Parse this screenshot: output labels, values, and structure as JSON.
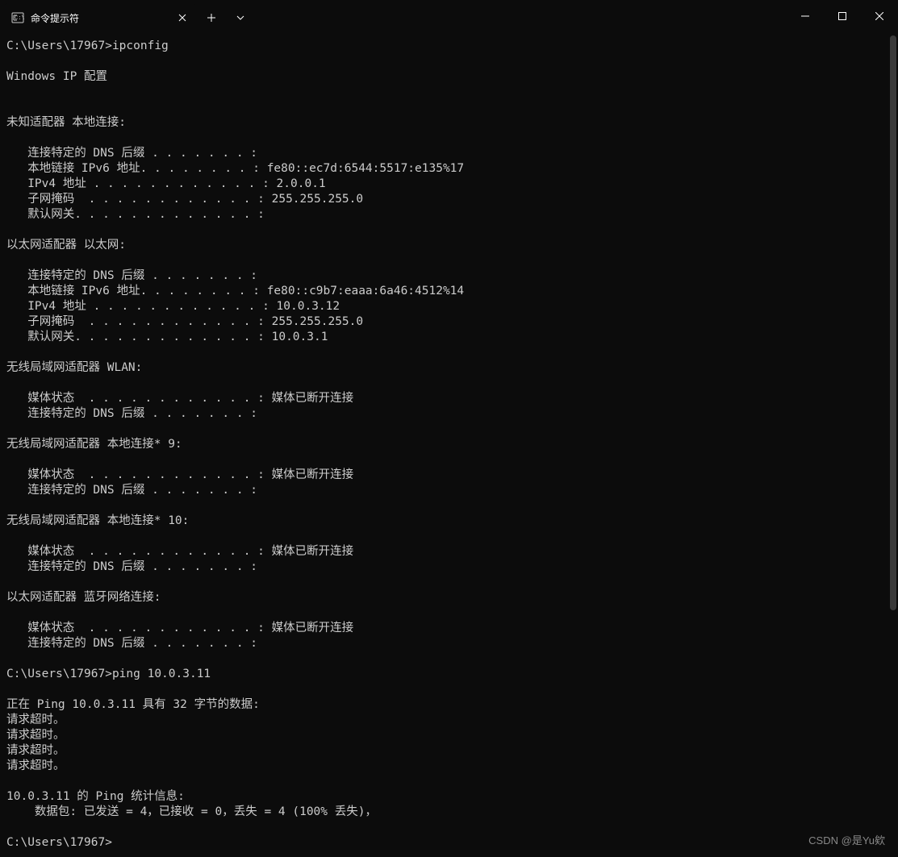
{
  "window": {
    "tab_title": "命令提示符",
    "watermark": "CSDN @是Yu欸"
  },
  "terminal": {
    "lines": [
      "C:\\Users\\17967>ipconfig",
      "",
      "Windows IP 配置",
      "",
      "",
      "未知适配器 本地连接:",
      "",
      "   连接特定的 DNS 后缀 . . . . . . . :",
      "   本地链接 IPv6 地址. . . . . . . . : fe80::ec7d:6544:5517:e135%17",
      "   IPv4 地址 . . . . . . . . . . . . : 2.0.0.1",
      "   子网掩码  . . . . . . . . . . . . : 255.255.255.0",
      "   默认网关. . . . . . . . . . . . . :",
      "",
      "以太网适配器 以太网:",
      "",
      "   连接特定的 DNS 后缀 . . . . . . . :",
      "   本地链接 IPv6 地址. . . . . . . . : fe80::c9b7:eaaa:6a46:4512%14",
      "   IPv4 地址 . . . . . . . . . . . . : 10.0.3.12",
      "   子网掩码  . . . . . . . . . . . . : 255.255.255.0",
      "   默认网关. . . . . . . . . . . . . : 10.0.3.1",
      "",
      "无线局域网适配器 WLAN:",
      "",
      "   媒体状态  . . . . . . . . . . . . : 媒体已断开连接",
      "   连接特定的 DNS 后缀 . . . . . . . :",
      "",
      "无线局域网适配器 本地连接* 9:",
      "",
      "   媒体状态  . . . . . . . . . . . . : 媒体已断开连接",
      "   连接特定的 DNS 后缀 . . . . . . . :",
      "",
      "无线局域网适配器 本地连接* 10:",
      "",
      "   媒体状态  . . . . . . . . . . . . : 媒体已断开连接",
      "   连接特定的 DNS 后缀 . . . . . . . :",
      "",
      "以太网适配器 蓝牙网络连接:",
      "",
      "   媒体状态  . . . . . . . . . . . . : 媒体已断开连接",
      "   连接特定的 DNS 后缀 . . . . . . . :",
      "",
      "C:\\Users\\17967>ping 10.0.3.11",
      "",
      "正在 Ping 10.0.3.11 具有 32 字节的数据:",
      "请求超时。",
      "请求超时。",
      "请求超时。",
      "请求超时。",
      "",
      "10.0.3.11 的 Ping 统计信息:",
      "    数据包: 已发送 = 4，已接收 = 0，丢失 = 4 (100% 丢失)，",
      "",
      "C:\\Users\\17967>"
    ]
  }
}
